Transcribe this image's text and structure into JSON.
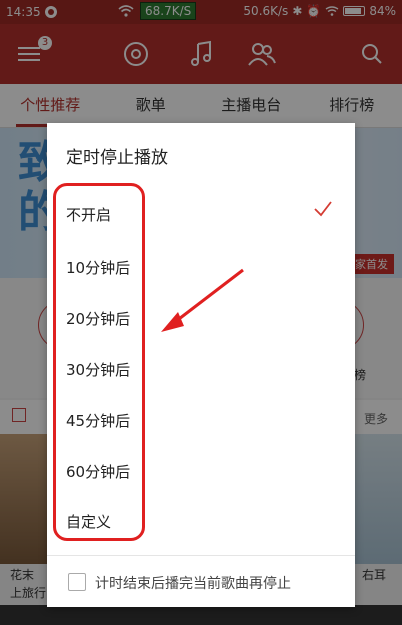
{
  "status_bar": {
    "time": "14:35",
    "net_speed_box": "68.7K/S",
    "net_speed": "50.6K/s",
    "battery": "84%"
  },
  "header": {
    "badge_count": "3"
  },
  "tabs": [
    {
      "label": "个性推荐"
    },
    {
      "label": "歌单"
    },
    {
      "label": "主播电台"
    },
    {
      "label": "排行榜"
    }
  ],
  "background": {
    "banner_text": "致\n的",
    "banner_tag": "家首发",
    "row_label": "榜",
    "caption_left_1": "花末",
    "caption_left_2": "上旅行",
    "caption_right": "右耳",
    "section_more": "更多"
  },
  "dialog": {
    "title": "定时停止播放",
    "options": [
      {
        "label": "不开启",
        "selected": true
      },
      {
        "label": "10分钟后",
        "selected": false
      },
      {
        "label": "20分钟后",
        "selected": false
      },
      {
        "label": "30分钟后",
        "selected": false
      },
      {
        "label": "45分钟后",
        "selected": false
      },
      {
        "label": "60分钟后",
        "selected": false
      },
      {
        "label": "自定义",
        "selected": false
      }
    ],
    "footer_checkbox_label": "计时结束后播完当前歌曲再停止",
    "footer_checked": false
  },
  "colors": {
    "brand": "#b3312c",
    "annotation": "#e02020"
  }
}
